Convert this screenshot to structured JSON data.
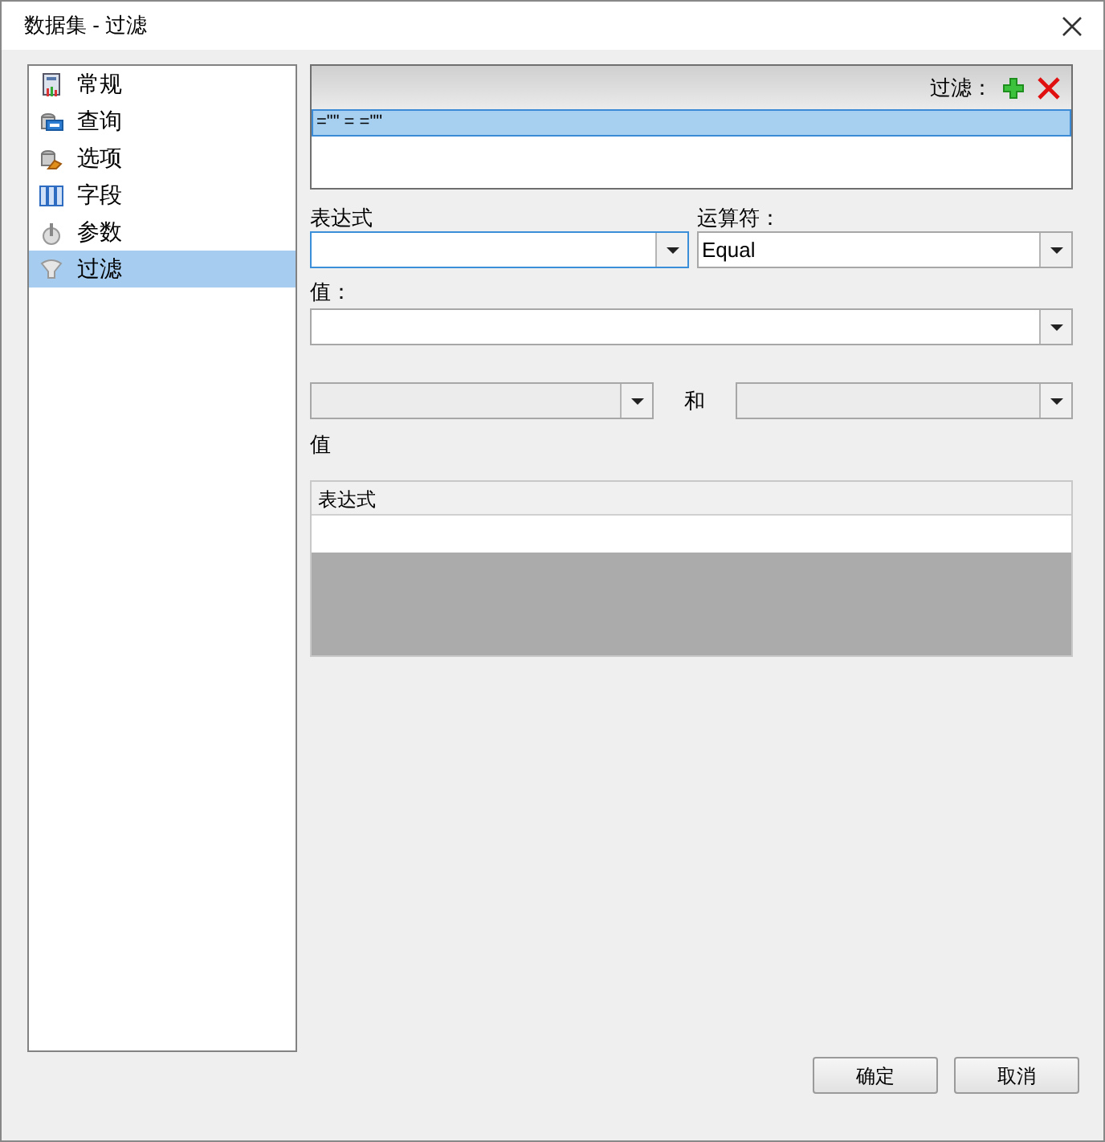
{
  "window": {
    "title": "数据集 - 过滤"
  },
  "sidebar": {
    "items": [
      {
        "label": "常规",
        "kind": "general",
        "selected": false
      },
      {
        "label": "查询",
        "kind": "query",
        "selected": false
      },
      {
        "label": "选项",
        "kind": "options",
        "selected": false
      },
      {
        "label": "字段",
        "kind": "fields",
        "selected": false
      },
      {
        "label": "参数",
        "kind": "parameters",
        "selected": false
      },
      {
        "label": "过滤",
        "kind": "filter",
        "selected": true
      }
    ]
  },
  "filters": {
    "label": "过滤：",
    "items": [
      {
        "text": "=\"\" = =\"\"",
        "selected": true
      }
    ]
  },
  "expression": {
    "label": "表达式",
    "focused": true
  },
  "operator": {
    "label": "运算符：",
    "value": "Equal",
    "focused": false
  },
  "value": {
    "label": "值："
  },
  "range": {
    "and_label": "和",
    "from": {
      "disabled": true
    },
    "to": {
      "disabled": true
    }
  },
  "values_label": "值",
  "values_table": {
    "columns": [
      "表达式"
    ]
  },
  "buttons": [
    "确定",
    "取消"
  ]
}
